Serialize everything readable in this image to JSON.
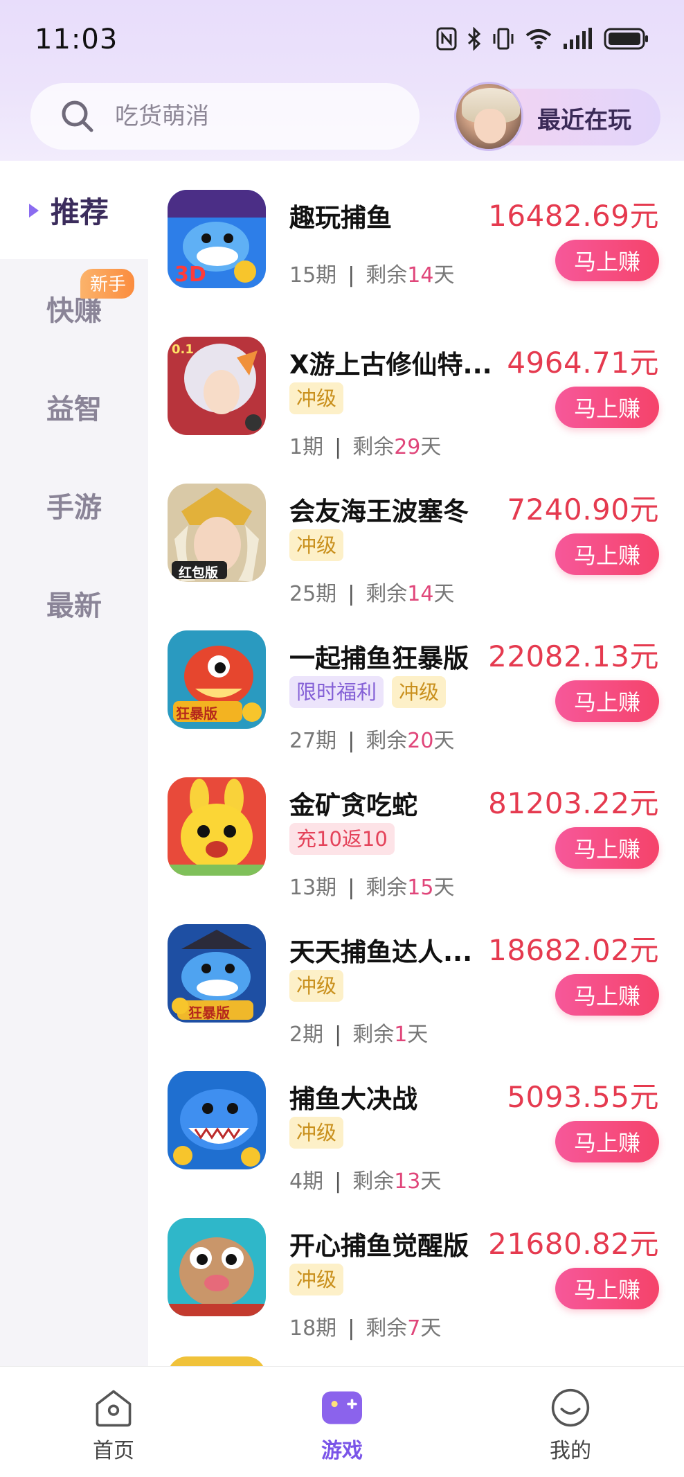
{
  "status_bar": {
    "time": "11:03"
  },
  "search": {
    "placeholder": "吃货萌消"
  },
  "recent": {
    "label": "最近在玩"
  },
  "sidebar": {
    "items": [
      {
        "label": "推荐",
        "active": true
      },
      {
        "label": "快赚",
        "badge": "新手"
      },
      {
        "label": "益智"
      },
      {
        "label": "手游"
      },
      {
        "label": "最新"
      }
    ]
  },
  "games": [
    {
      "name": "趣玩捕鱼",
      "tags": [],
      "period": "15期",
      "remain_prefix": "剩余",
      "remain_days": "14",
      "remain_suffix": "天",
      "amount": "16482.69元",
      "button": "马上赚"
    },
    {
      "name": "X游上古修仙特...",
      "tags": [
        "冲级"
      ],
      "period": "1期",
      "remain_prefix": "剩余",
      "remain_days": "29",
      "remain_suffix": "天",
      "amount": "4964.71元",
      "button": "马上赚"
    },
    {
      "name": "会友海王波塞冬",
      "tags": [
        "冲级"
      ],
      "period": "25期",
      "remain_prefix": "剩余",
      "remain_days": "14",
      "remain_suffix": "天",
      "amount": "7240.90元",
      "button": "马上赚"
    },
    {
      "name": "一起捕鱼狂暴版",
      "tags": [
        "限时福利",
        "冲级"
      ],
      "period": "27期",
      "remain_prefix": "剩余",
      "remain_days": "20",
      "remain_suffix": "天",
      "amount": "22082.13元",
      "button": "马上赚"
    },
    {
      "name": "金矿贪吃蛇",
      "tags": [
        "充10返10"
      ],
      "period": "13期",
      "remain_prefix": "剩余",
      "remain_days": "15",
      "remain_suffix": "天",
      "amount": "81203.22元",
      "button": "马上赚"
    },
    {
      "name": "天天捕鱼达人...",
      "tags": [
        "冲级"
      ],
      "period": "2期",
      "remain_prefix": "剩余",
      "remain_days": "1",
      "remain_suffix": "天",
      "amount": "18682.02元",
      "button": "马上赚"
    },
    {
      "name": "捕鱼大决战",
      "tags": [
        "冲级"
      ],
      "period": "4期",
      "remain_prefix": "剩余",
      "remain_days": "13",
      "remain_suffix": "天",
      "amount": "5093.55元",
      "button": "马上赚"
    },
    {
      "name": "开心捕鱼觉醒版",
      "tags": [
        "冲级"
      ],
      "period": "18期",
      "remain_prefix": "剩余",
      "remain_days": "7",
      "remain_suffix": "天",
      "amount": "21680.82元",
      "button": "马上赚"
    }
  ],
  "icon_names": [
    "shark-game-icon",
    "xian-warrior-icon",
    "poseidon-icon",
    "dragon-fish-icon",
    "rabbit-snake-icon",
    "pirate-shark-icon",
    "blue-shark-icon",
    "pufferfish-icon"
  ],
  "tabbar": {
    "items": [
      {
        "label": "首页",
        "icon": "home-icon"
      },
      {
        "label": "游戏",
        "icon": "gamepad-icon",
        "active": true
      },
      {
        "label": "我的",
        "icon": "smiley-icon"
      }
    ]
  },
  "colors": {
    "accent": "#7a55e8",
    "amount": "#e53a4f",
    "button": "#f5436a"
  }
}
